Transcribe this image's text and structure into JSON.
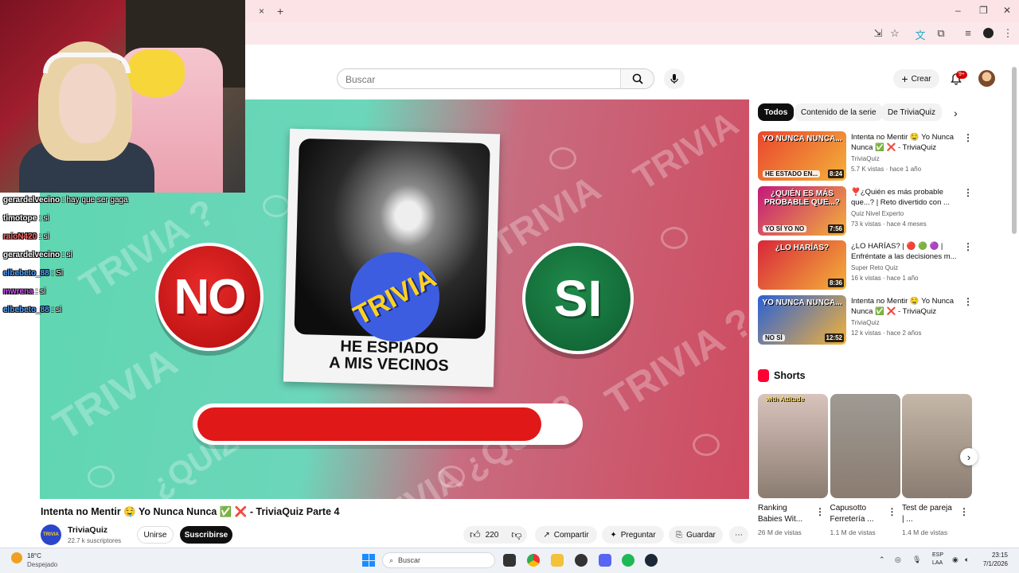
{
  "browser": {
    "tab_close": "×",
    "tab_new": "+",
    "window_controls": [
      "–",
      "❐",
      "✕"
    ]
  },
  "masthead": {
    "search_placeholder": "Buscar",
    "create_label": "Crear",
    "notifications_badge": "9+"
  },
  "video": {
    "title": "Intenta no Mentir 🤤 Yo Nunca Nunca ✅ ❌ - TriviaQuiz Parte 4",
    "thumb_no": "NO",
    "thumb_si": "SI",
    "thumb_card_text_1": "HE ESPIADO",
    "thumb_card_text_2": "A MIS VECINOS",
    "thumb_badge": "TRIVIA",
    "timer_progress": 0.9,
    "channel_name": "TriviaQuiz",
    "channel_avatar_text": "TRIVIA",
    "subscribers": "22.7 k suscriptores",
    "join_label": "Unirse",
    "subscribe_label": "Suscribirse",
    "likes": "220",
    "share_label": "Compartir",
    "ask_label": "Preguntar",
    "save_label": "Guardar"
  },
  "chat": [
    {
      "user": "gerardelvecino",
      "msg": ": hay que ser gaga",
      "color": "#ffffff"
    },
    {
      "user": "timotope",
      "msg": ": si",
      "color": "#ffffff"
    },
    {
      "user": "raioN420",
      "msg": ": si",
      "color": "#ff6b6b"
    },
    {
      "user": "gerardelvecino",
      "msg": ": si",
      "color": "#ffffff"
    },
    {
      "user": "elbebeto_88",
      "msg": ": Si",
      "color": "#4fa3ff"
    },
    {
      "user": "mwrena",
      "msg": ": si",
      "color": "#d94fff"
    },
    {
      "user": "elbebeto_88",
      "msg": ": si",
      "color": "#4fa3ff"
    }
  ],
  "sidebar": {
    "chips": [
      "Todos",
      "Contenido de la serie",
      "De TriviaQuiz"
    ],
    "recommendations": [
      {
        "thumb_text": "YO NUNCA NUNCA...",
        "thumb_sub": "HE ESTADO EN...",
        "duration": "8:24",
        "title": "Intenta no Mentir 🤤 Yo Nunca Nunca ✅ ❌ - TriviaQuiz Part...",
        "channel": "TriviaQuiz",
        "meta": "5.7 K vistas · hace 1 año",
        "color": "#e9452f"
      },
      {
        "thumb_text": "¿QUIÉN ES MÁS PROBABLE QUE...?",
        "thumb_sub": "YO SÍ   YO NO",
        "duration": "7:56",
        "title": "❣️¿Quién es más probable que...? | Reto divertido con ...",
        "channel": "Quiz Nivel Experto",
        "meta": "73 k vistas · hace 4 meses",
        "color": "#c2197a"
      },
      {
        "thumb_text": "¿LO HARÍAS?",
        "thumb_sub": "",
        "duration": "8:36",
        "title": "¿LO HARÍAS? | 🔴 🟢 🟣 | Enfréntate a las decisiones m...",
        "channel": "Super Reto Quiz",
        "meta": "16 k vistas · hace 1 año",
        "color": "#d8263b"
      },
      {
        "thumb_text": "YO NUNCA NUNCA...",
        "thumb_sub": "NO   SÍ",
        "duration": "12:52",
        "title": "Intenta no Mentir 🤤 Yo Nunca Nunca ✅ ❌ - TriviaQuiz Part...",
        "channel": "TriviaQuiz",
        "meta": "12 k vistas · hace 2 años",
        "color": "#2a61d6"
      }
    ]
  },
  "shorts": {
    "label": "Shorts",
    "items": [
      {
        "title": "Ranking Babies Wit...",
        "views": "26 M de vistas",
        "overlay": "with Attitude",
        "color": "#d9c3bd"
      },
      {
        "title": "Capusotto Ferretería ...",
        "views": "1.1 M de vistas",
        "overlay": "",
        "color": "#9e9a93"
      },
      {
        "title": "Test de pareja | ...",
        "views": "1.4 M de vistas",
        "overlay": "",
        "color": "#c4b7a8"
      }
    ]
  },
  "taskbar": {
    "weather_temp": "18°C",
    "weather_desc": "Despejado",
    "search_placeholder": "Buscar",
    "lang_1": "ESP",
    "lang_2": "LAA",
    "time": "23:15",
    "date": "7/1/2026"
  }
}
